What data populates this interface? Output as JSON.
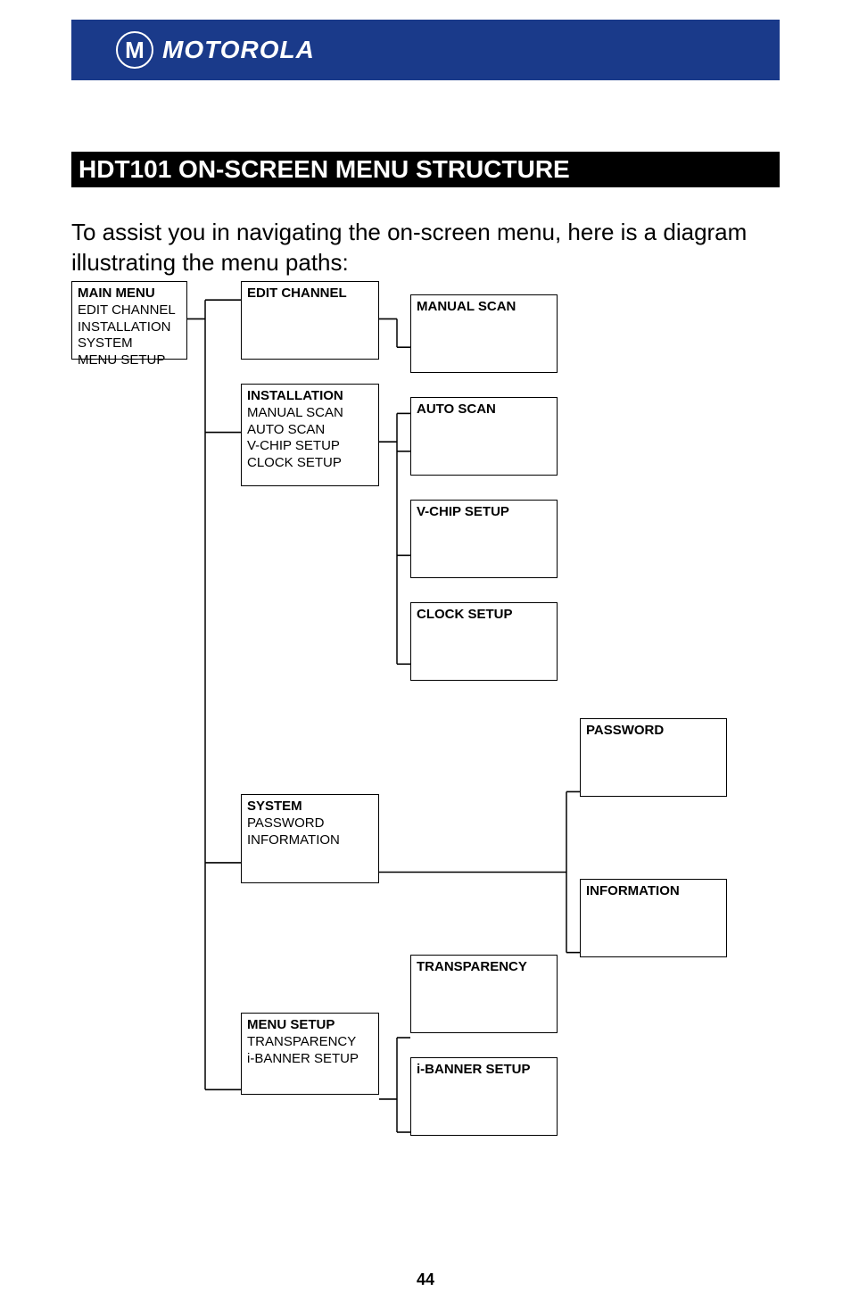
{
  "brand": "MOTOROLA",
  "logo_letter": "M",
  "section_title": "HDT101 ON-SCREEN MENU STRUCTURE",
  "intro": "To assist you in navigating the on-screen menu, here is a diagram illustrating the menu paths:",
  "page_number": "44",
  "menu": {
    "main": {
      "title": "MAIN MENU",
      "items": [
        "EDIT CHANNEL",
        "INSTALLATION",
        "SYSTEM",
        "MENU SETUP"
      ]
    },
    "edit_channel": {
      "title": "EDIT CHANNEL"
    },
    "installation": {
      "title": "INSTALLATION",
      "items": [
        "MANUAL SCAN",
        "AUTO SCAN",
        "V-CHIP SETUP",
        "CLOCK SETUP"
      ]
    },
    "manual_scan": {
      "title": "MANUAL SCAN"
    },
    "auto_scan": {
      "title": "AUTO SCAN"
    },
    "vchip": {
      "title": "V-CHIP SETUP"
    },
    "clock": {
      "title": "CLOCK SETUP"
    },
    "system": {
      "title": "SYSTEM",
      "items": [
        "PASSWORD",
        "INFORMATION"
      ]
    },
    "password": {
      "title": "PASSWORD"
    },
    "information": {
      "title": "INFORMATION"
    },
    "menu_setup": {
      "title": "MENU SETUP",
      "items": [
        "TRANSPARENCY",
        "i-BANNER SETUP"
      ]
    },
    "transparency": {
      "title": "TRANSPARENCY"
    },
    "ibanner": {
      "title": "i-BANNER SETUP"
    }
  }
}
